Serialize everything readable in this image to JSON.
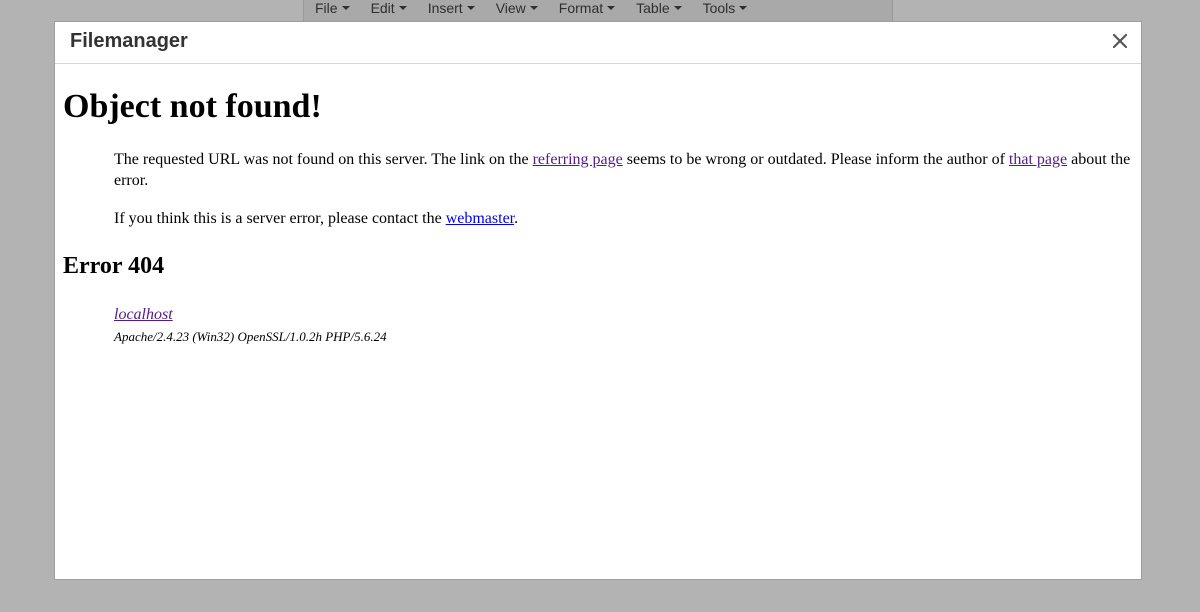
{
  "background": {
    "menubar": [
      {
        "label": "File"
      },
      {
        "label": "Edit"
      },
      {
        "label": "Insert"
      },
      {
        "label": "View"
      },
      {
        "label": "Format"
      },
      {
        "label": "Table"
      },
      {
        "label": "Tools"
      }
    ]
  },
  "dialog": {
    "title": "Filemanager",
    "close_icon": "close-icon"
  },
  "page": {
    "heading": "Object not found!",
    "para1": {
      "text_a": "The requested URL was not found on this server. The link on the ",
      "link_referring": "referring page",
      "text_b": " seems to be wrong or outdated. Please inform the author of ",
      "link_that_page": "that page",
      "text_c": " about the error."
    },
    "para2": {
      "text_a": "If you think this is a server error, please contact the ",
      "link_webmaster": "webmaster",
      "text_b": "."
    },
    "error_code": "Error 404",
    "address": {
      "host": "localhost",
      "server": "Apache/2.4.23 (Win32) OpenSSL/1.0.2h PHP/5.6.24"
    }
  },
  "colors": {
    "overlay": "#b3b3b3",
    "visited_link": "#551a8b",
    "link": "#0000ee"
  }
}
